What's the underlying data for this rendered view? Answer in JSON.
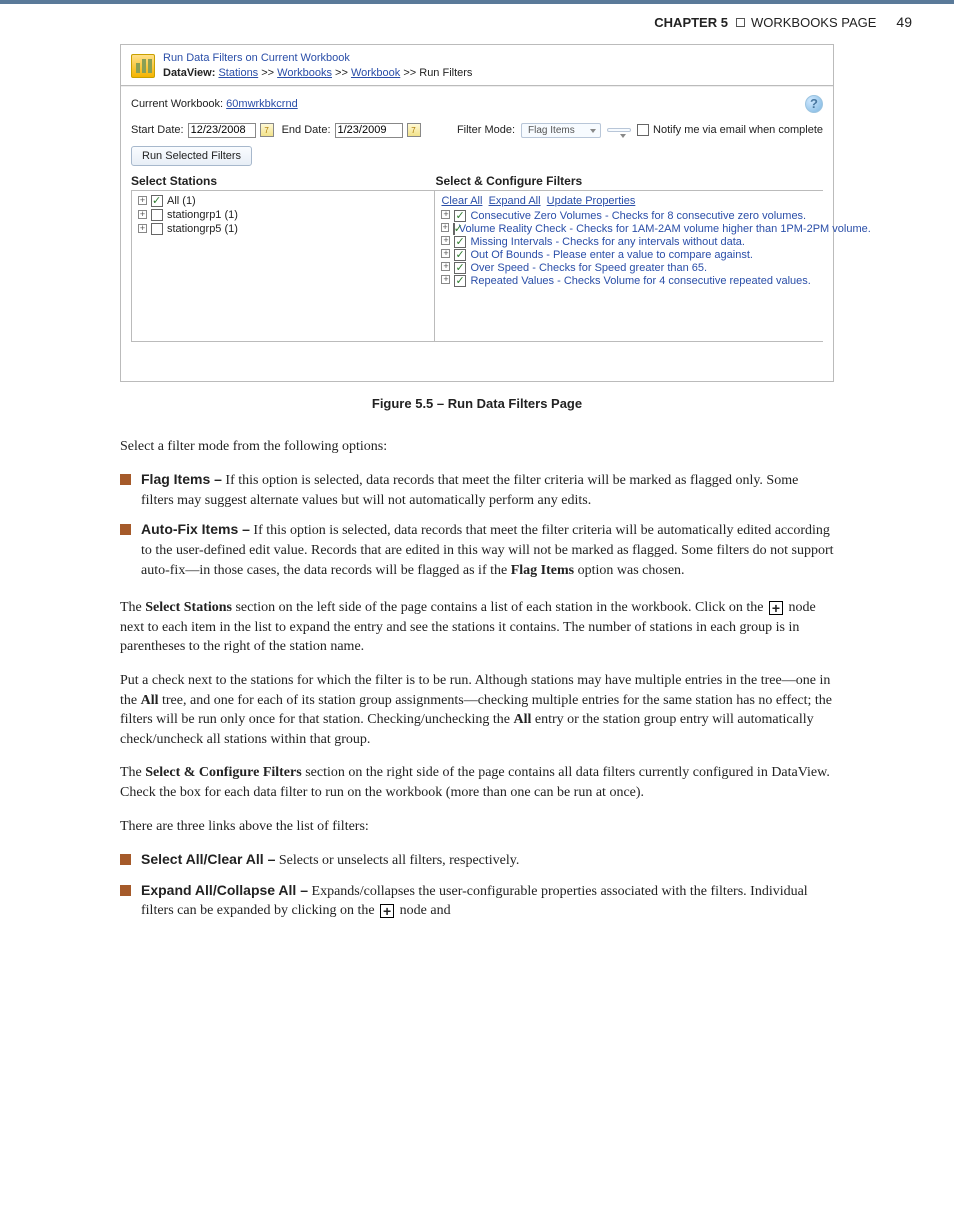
{
  "header": {
    "chapter_label": "CHAPTER 5",
    "chapter_title": "WORKBOOKS PAGE",
    "page_number": "49"
  },
  "shot": {
    "panel_title": "Run Data Filters on Current Workbook",
    "breadcrumb_label": "DataView:",
    "breadcrumb_parts": [
      "Stations",
      "Workbooks",
      "Workbook"
    ],
    "breadcrumb_last": "Run Filters",
    "current_workbook_label": "Current Workbook:",
    "current_workbook_link": "60mwrkbkcrnd",
    "start_date_label": "Start Date:",
    "start_date_value": "12/23/2008",
    "end_date_label": "End Date:",
    "end_date_value": "1/23/2009",
    "filter_mode_label": "Filter Mode:",
    "filter_mode_value": "Flag Items",
    "notify_label": "Notify me via email when complete",
    "run_button": "Run Selected Filters",
    "select_stations_header": "Select Stations",
    "select_filters_header": "Select & Configure Filters",
    "stations": [
      {
        "label": "All (1)",
        "checked": true
      },
      {
        "label": "stationgrp1 (1)",
        "checked": false
      },
      {
        "label": "stationgrp5 (1)",
        "checked": false
      }
    ],
    "filter_links": [
      "Clear All",
      "Expand All",
      "Update Properties"
    ],
    "filters": [
      "Consecutive Zero Volumes - Checks for 8 consecutive zero volumes.",
      "Volume Reality Check - Checks for 1AM-2AM volume higher than 1PM-2PM volume.",
      "Missing Intervals - Checks for any intervals without data.",
      "Out Of Bounds - Please enter a value to compare against.",
      "Over Speed - Checks for Speed greater than 65.",
      "Repeated Values - Checks Volume for 4 consecutive repeated values."
    ],
    "help_tooltip": "?"
  },
  "caption": "Figure 5.5 – Run Data Filters Page",
  "para_intro": "Select a filter mode from the following options:",
  "bullets1": [
    {
      "label": "Flag Items –",
      "text": " If this option is selected, data records that meet the filter criteria will be marked as flagged only. Some filters may suggest alternate values but will not automatically perform any edits."
    },
    {
      "label": "Auto-Fix Items –",
      "text": " If this option is selected, data records that meet the filter criteria will be automatically edited according to the user-defined edit value. Records that are edited in this way will not be marked as flagged. Some filters do not support auto-fix—in those cases, the data records will be flagged as if the ",
      "bold_inline": "Flag Items",
      "tail": " option was chosen."
    }
  ],
  "para_select_stations_1a": "The ",
  "para_select_stations_bold1": "Select Stations",
  "para_select_stations_1b": " section on the left side of the page contains a list of each station in the workbook. Click on the ",
  "para_select_stations_1c": " node next to each item in the list to expand the entry and see the stations it contains. The number of stations in each group is in parentheses to the right of the station name.",
  "para_put_check_a": "Put a check next to the stations for which the filter is to be run. Although stations may have multiple entries in the tree—one in the ",
  "para_put_check_bold1": "All",
  "para_put_check_b": " tree, and one for each of its station group assignments—checking multiple entries for the same station has no effect; the filters will be run only once for that station. Checking/unchecking the ",
  "para_put_check_bold2": "All",
  "para_put_check_c": " entry or the station group entry will automatically check/uncheck all stations within that group.",
  "para_configure_a": "The ",
  "para_configure_bold": "Select & Configure Filters",
  "para_configure_b": " section on the right side of the page contains all data filters currently configured in DataView. Check the box for each data filter to run on the workbook (more than one can be run at once).",
  "para_three_links": "There are three links above the list of filters:",
  "bullets2": [
    {
      "label": "Select All/Clear All  –",
      "text": " Selects or unselects all filters, respectively."
    },
    {
      "label": "Expand All/Collapse All –",
      "text": " Expands/collapses the user-configurable properties associated with the filters. Individual filters can be expanded by clicking on the ",
      "has_plus_tail": true,
      "tail": " node and"
    }
  ],
  "plus_glyph": "+"
}
